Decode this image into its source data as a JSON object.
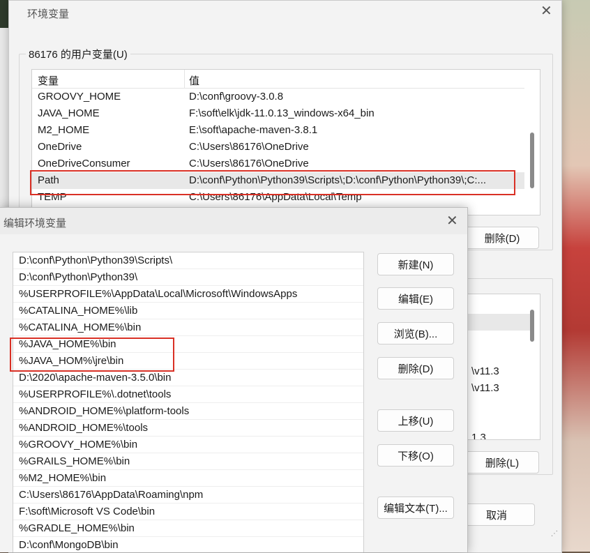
{
  "env_dialog": {
    "title": "环境变量",
    "close_glyph": "✕",
    "user_group_label": "86176 的用户变量(U)",
    "user_columns": [
      "变量",
      "值"
    ],
    "user_vars": [
      {
        "name": "GROOVY_HOME",
        "value": "D:\\conf\\groovy-3.0.8"
      },
      {
        "name": "JAVA_HOME",
        "value": "F:\\soft\\elk\\jdk-11.0.13_windows-x64_bin"
      },
      {
        "name": "M2_HOME",
        "value": "E:\\soft\\apache-maven-3.8.1"
      },
      {
        "name": "OneDrive",
        "value": "C:\\Users\\86176\\OneDrive"
      },
      {
        "name": "OneDriveConsumer",
        "value": "C:\\Users\\86176\\OneDrive"
      },
      {
        "name": "Path",
        "value": "D:\\conf\\Python\\Python39\\Scripts\\;D:\\conf\\Python\\Python39\\;C:..."
      },
      {
        "name": "TEMP",
        "value": "C:\\Users\\86176\\AppData\\Local\\Temp"
      }
    ],
    "selected_user_var": "Path",
    "user_delete_button": "删除(D)",
    "sys_partial_values": [
      "\\v11.3",
      "\\v11.3",
      "1.3"
    ],
    "sys_delete_button": "删除(L)",
    "cancel_button": "取消"
  },
  "edit_dialog": {
    "title": "编辑环境变量",
    "close_glyph": "✕",
    "paths": [
      "D:\\conf\\Python\\Python39\\Scripts\\",
      "D:\\conf\\Python\\Python39\\",
      "%USERPROFILE%\\AppData\\Local\\Microsoft\\WindowsApps",
      "%CATALINA_HOME%\\lib",
      "%CATALINA_HOME%\\bin",
      "%JAVA_HOME%\\bin",
      "%JAVA_HOM%\\jre\\bin",
      "D:\\2020\\apache-maven-3.5.0\\bin",
      "%USERPROFILE%\\.dotnet\\tools",
      "%ANDROID_HOME%\\platform-tools",
      "%ANDROID_HOME%\\tools",
      "%GROOVY_HOME%\\bin",
      "%GRAILS_HOME%\\bin",
      "%M2_HOME%\\bin",
      "C:\\Users\\86176\\AppData\\Roaming\\npm",
      "F:\\soft\\Microsoft VS Code\\bin",
      "%GRADLE_HOME%\\bin",
      "D:\\conf\\MongoDB\\bin"
    ],
    "buttons": {
      "new": "新建(N)",
      "edit": "编辑(E)",
      "browse": "浏览(B)...",
      "delete": "删除(D)",
      "move_up": "上移(U)",
      "move_down": "下移(O)",
      "edit_text": "编辑文本(T)..."
    }
  },
  "colors": {
    "highlight": "#d93025",
    "dialog_bg": "#f3f3f3",
    "selection": "#e8e8e8"
  }
}
